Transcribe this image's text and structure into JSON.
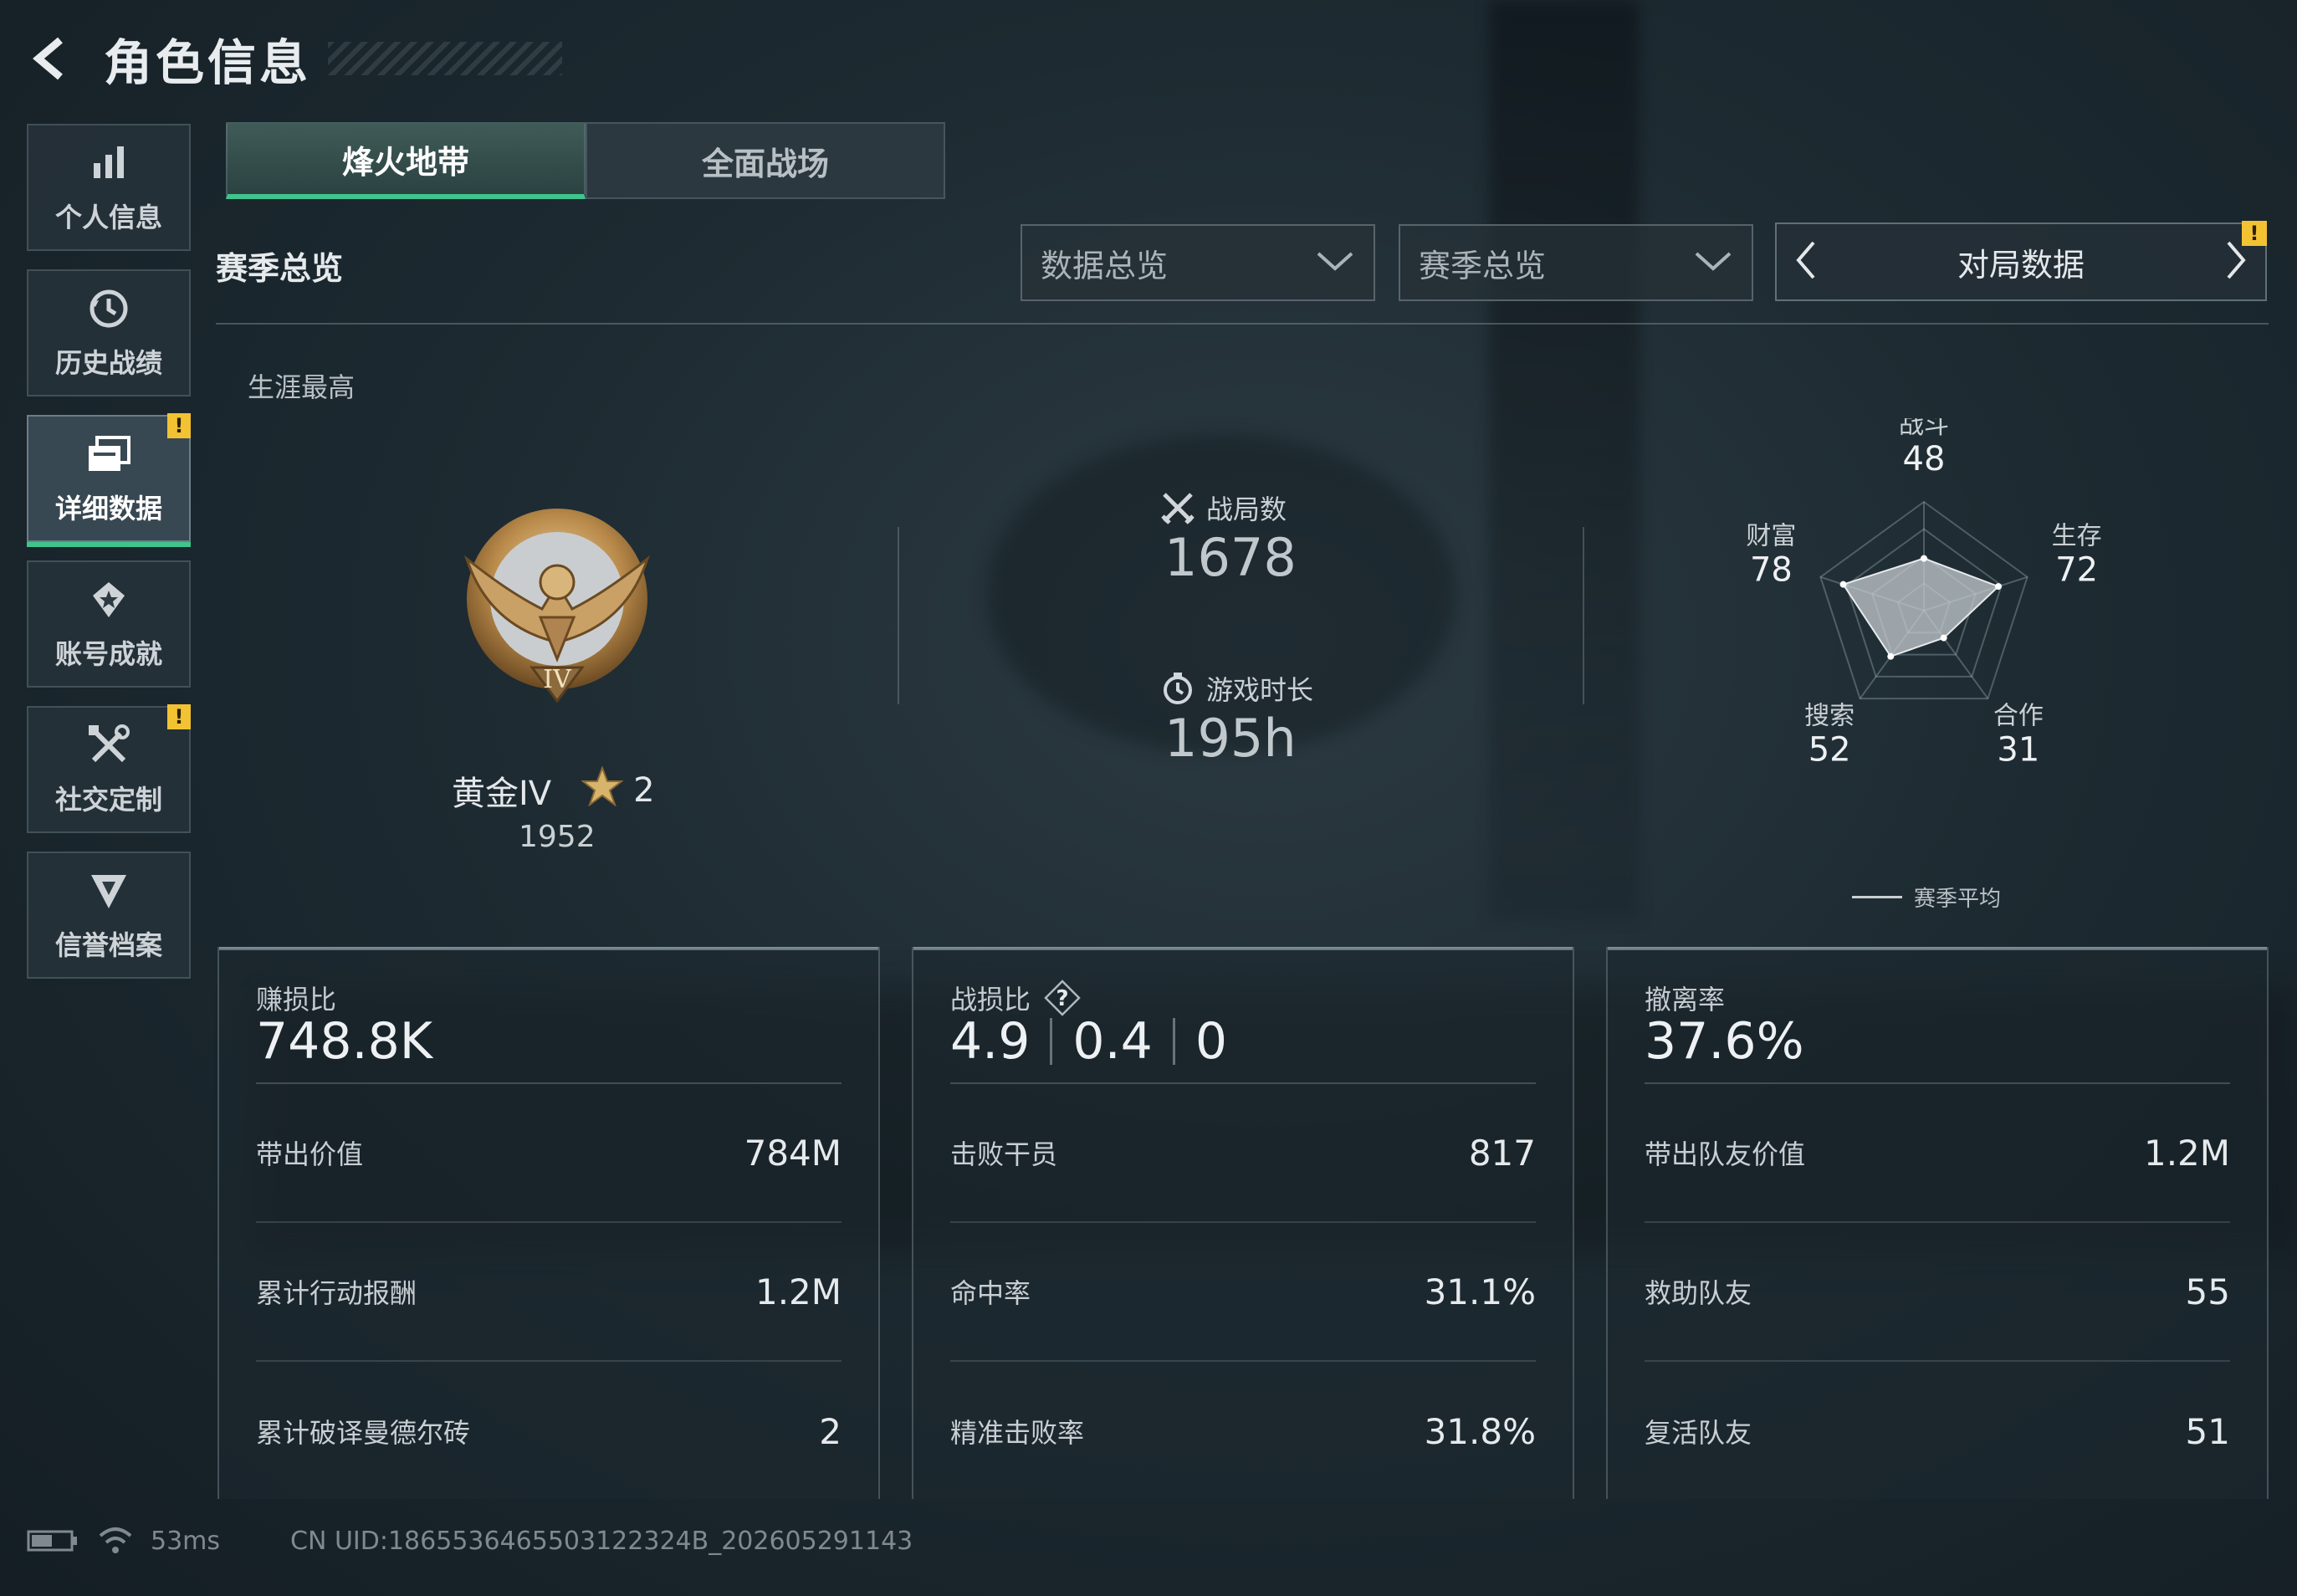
{
  "header": {
    "title": "角色信息"
  },
  "sidenav": [
    {
      "label": "个人信息",
      "icon": "bar-chart-icon",
      "active": false,
      "alert": ""
    },
    {
      "label": "历史战绩",
      "icon": "history-clock-icon",
      "active": false,
      "alert": ""
    },
    {
      "label": "详细数据",
      "icon": "detail-cards-icon",
      "active": true,
      "alert": "!"
    },
    {
      "label": "账号成就",
      "icon": "achievement-badge-icon",
      "active": false,
      "alert": ""
    },
    {
      "label": "社交定制",
      "icon": "tools-icon",
      "active": false,
      "alert": "!"
    },
    {
      "label": "信誉档案",
      "icon": "reputation-shield-icon",
      "active": false,
      "alert": ""
    }
  ],
  "tabs": [
    {
      "label": "烽火地带",
      "active": true
    },
    {
      "label": "全面战场",
      "active": false
    }
  ],
  "overview": {
    "section_title": "赛季总览",
    "dropdown1": "数据总览",
    "dropdown2": "赛季总览",
    "match_selector": "对局数据",
    "match_alert": "!",
    "career_label": "生涯最高",
    "rank": {
      "name": "黄金IV",
      "emblem_numeral": "IV",
      "stars": "2",
      "points": "1952"
    },
    "battles": {
      "label": "战局数",
      "value": "1678"
    },
    "playtime": {
      "label": "游戏时长",
      "value": "195h"
    }
  },
  "radar": {
    "axes": [
      {
        "label": "战斗",
        "value": 48
      },
      {
        "label": "生存",
        "value": 72
      },
      {
        "label": "合作",
        "value": 31
      },
      {
        "label": "搜索",
        "value": 52
      },
      {
        "label": "财富",
        "value": 78
      }
    ],
    "max": 100,
    "legend": "赛季平均",
    "fill_color": "#c5ccd0"
  },
  "cards": [
    {
      "title": "赚损比",
      "main": "748.8K",
      "rows": [
        {
          "label": "带出价值",
          "value": "784M"
        },
        {
          "label": "累计行动报酬",
          "value": "1.2M"
        },
        {
          "label": "累计破译曼德尔砖",
          "value": "2"
        }
      ]
    },
    {
      "title": "战损比",
      "main_parts": [
        "4.9",
        "0.4",
        "0"
      ],
      "help": "?",
      "rows": [
        {
          "label": "击败干员",
          "value": "817"
        },
        {
          "label": "命中率",
          "value": "31.1%"
        },
        {
          "label": "精准击败率",
          "value": "31.8%"
        }
      ]
    },
    {
      "title": "撤离率",
      "main": "37.6%",
      "rows": [
        {
          "label": "带出队友价值",
          "value": "1.2M"
        },
        {
          "label": "救助队友",
          "value": "55"
        },
        {
          "label": "复活队友",
          "value": "51"
        }
      ]
    }
  ],
  "footer": {
    "ping": "53ms",
    "uid": "CN UID:1865536465503122324B_202605291143"
  },
  "colors": {
    "accent": "#3fc48c",
    "alert": "#f2c233"
  }
}
